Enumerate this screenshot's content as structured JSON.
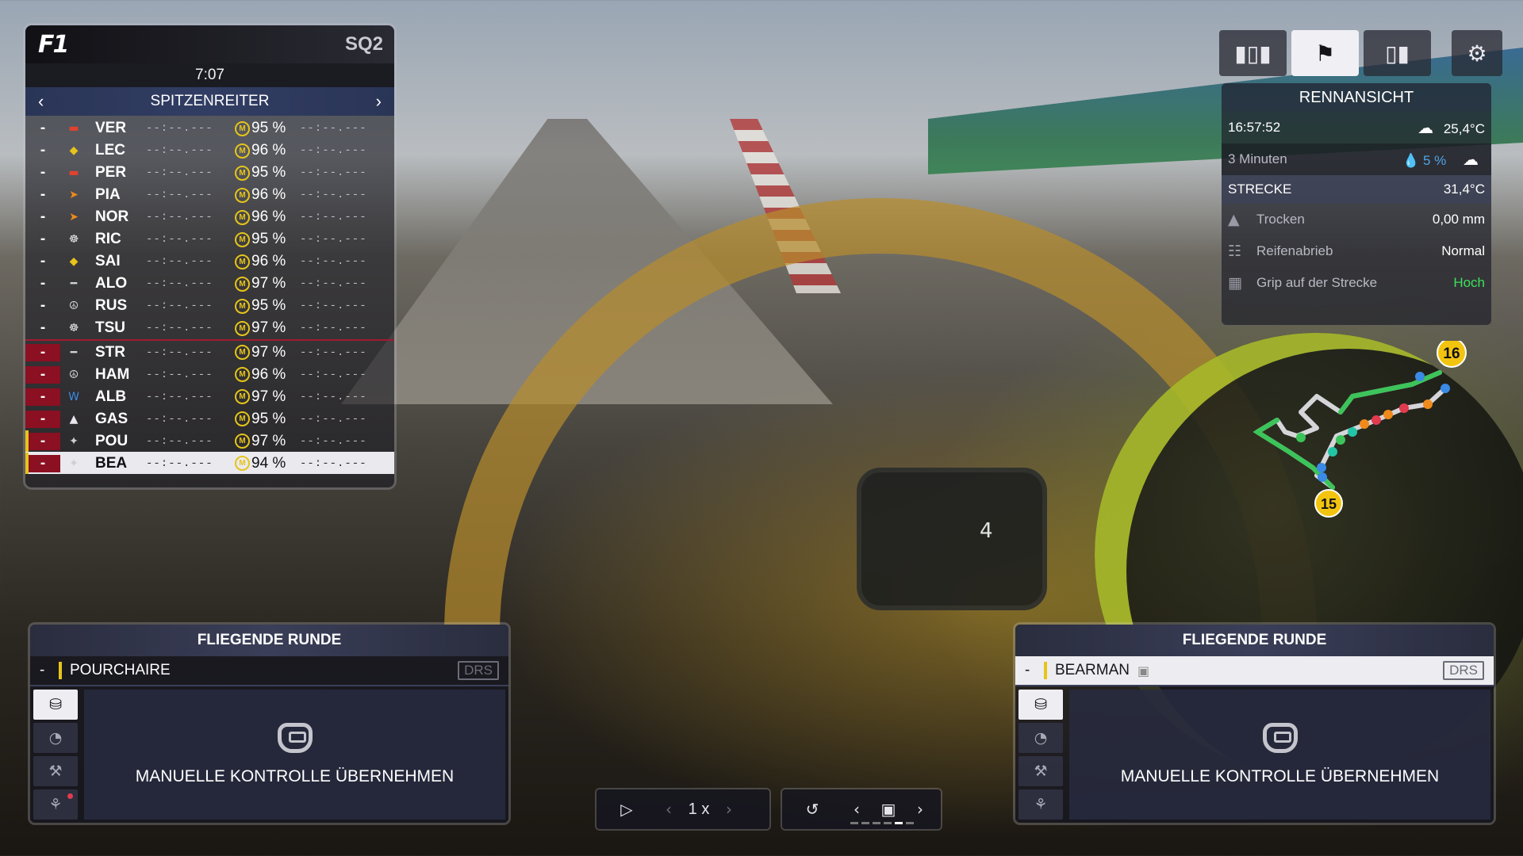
{
  "leaderboard": {
    "logo": "F1",
    "session": "SQ2",
    "time": "7:07",
    "mode_label": "SPITZENREITER",
    "rows": [
      {
        "pos": "-",
        "team_icon": "redbull-logo",
        "code": "VER",
        "t1": "--:--.---",
        "pct": "95 %",
        "t2": "--:--.---"
      },
      {
        "pos": "-",
        "team_icon": "ferrari-logo",
        "code": "LEC",
        "t1": "--:--.---",
        "pct": "96 %",
        "t2": "--:--.---"
      },
      {
        "pos": "-",
        "team_icon": "redbull-logo",
        "code": "PER",
        "t1": "--:--.---",
        "pct": "95 %",
        "t2": "--:--.---"
      },
      {
        "pos": "-",
        "team_icon": "mclaren-logo",
        "code": "PIA",
        "t1": "--:--.---",
        "pct": "96 %",
        "t2": "--:--.---"
      },
      {
        "pos": "-",
        "team_icon": "mclaren-logo",
        "code": "NOR",
        "t1": "--:--.---",
        "pct": "96 %",
        "t2": "--:--.---"
      },
      {
        "pos": "-",
        "team_icon": "rb-logo",
        "code": "RIC",
        "t1": "--:--.---",
        "pct": "95 %",
        "t2": "--:--.---"
      },
      {
        "pos": "-",
        "team_icon": "ferrari-logo",
        "code": "SAI",
        "t1": "--:--.---",
        "pct": "96 %",
        "t2": "--:--.---"
      },
      {
        "pos": "-",
        "team_icon": "astonmartin-logo",
        "code": "ALO",
        "t1": "--:--.---",
        "pct": "97 %",
        "t2": "--:--.---"
      },
      {
        "pos": "-",
        "team_icon": "mercedes-logo",
        "code": "RUS",
        "t1": "--:--.---",
        "pct": "95 %",
        "t2": "--:--.---"
      },
      {
        "pos": "-",
        "team_icon": "rb-logo",
        "code": "TSU",
        "t1": "--:--.---",
        "pct": "97 %",
        "t2": "--:--.---"
      },
      {
        "pos": "-",
        "team_icon": "astonmartin-logo",
        "code": "STR",
        "t1": "--:--.---",
        "pct": "97 %",
        "t2": "--:--.---"
      },
      {
        "pos": "-",
        "team_icon": "mercedes-logo",
        "code": "HAM",
        "t1": "--:--.---",
        "pct": "96 %",
        "t2": "--:--.---"
      },
      {
        "pos": "-",
        "team_icon": "williams-logo",
        "code": "ALB",
        "t1": "--:--.---",
        "pct": "97 %",
        "t2": "--:--.---"
      },
      {
        "pos": "-",
        "team_icon": "alpine-logo",
        "code": "GAS",
        "t1": "--:--.---",
        "pct": "95 %",
        "t2": "--:--.---"
      },
      {
        "pos": "-",
        "team_icon": "haas-logo",
        "code": "POU",
        "t1": "--:--.---",
        "pct": "97 %",
        "t2": "--:--.---"
      },
      {
        "pos": "-",
        "team_icon": "haas-logo",
        "code": "BEA",
        "t1": "--:--.---",
        "pct": "94 %",
        "t2": "--:--.---"
      }
    ],
    "tyre_letter": "M"
  },
  "topbar": {
    "icons": [
      "bar-chart-icon",
      "flag-icon",
      "timing-icon",
      "gear-icon"
    ],
    "active": "flag-icon"
  },
  "weather": {
    "title": "RENNANSICHT",
    "time": "16:57:52",
    "air_temp": "25,4°C",
    "forecast_time": "3 Minuten",
    "rain_chance": "5 %",
    "track_section": "STRECKE",
    "track_temp": "31,4°C",
    "conditions": [
      {
        "icon": "track-dry-icon",
        "label": "Trocken",
        "value": "0,00 mm",
        "good": false
      },
      {
        "icon": "tyre-wear-icon",
        "label": "Reifenabrieb",
        "value": "Normal",
        "good": false
      },
      {
        "icon": "grip-icon",
        "label": "Grip auf der Strecke",
        "value": "Hoch",
        "good": true
      }
    ]
  },
  "map": {
    "markers": [
      "16",
      "15"
    ],
    "colors": {
      "marker": "#f2c40f",
      "track": "#e8e8ee",
      "green": "#3cc45a"
    }
  },
  "panels": {
    "left": {
      "title": "FLIEGENDE RUNDE",
      "dash": "-",
      "driver": "POURCHAIRE",
      "drs": "DRS",
      "action": "MANUELLE KONTROLLE ÜBERNEHMEN"
    },
    "right": {
      "title": "FLIEGENDE RUNDE",
      "dash": "-",
      "driver": "BEARMAN",
      "drs": "DRS",
      "action": "MANUELLE KONTROLLE ÜBERNEHMEN"
    }
  },
  "playback": {
    "speed": "1 x"
  },
  "colors": {
    "accent_yellow": "#e6c419",
    "danger_red": "#8b1022",
    "good_green": "#3be25a",
    "rain_blue": "#4fa4e6"
  }
}
